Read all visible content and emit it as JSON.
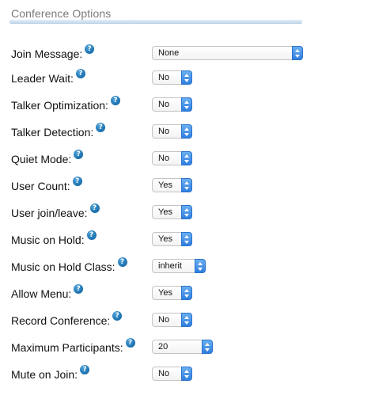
{
  "section": {
    "title": "Conference Options"
  },
  "help_icon_glyph": "?",
  "help_icon_name": "question-circle-icon",
  "accent_color": "#2f7fe0",
  "options": [
    {
      "label": "Join Message:",
      "value": "None"
    },
    {
      "label": "Leader Wait:",
      "value": "No"
    },
    {
      "label": "Talker Optimization:",
      "value": "No"
    },
    {
      "label": "Talker Detection:",
      "value": "No"
    },
    {
      "label": "Quiet Mode:",
      "value": "No"
    },
    {
      "label": "User Count:",
      "value": "Yes"
    },
    {
      "label": "User join/leave:",
      "value": "Yes"
    },
    {
      "label": "Music on Hold:",
      "value": "Yes"
    },
    {
      "label": "Music on Hold Class:",
      "value": "inherit"
    },
    {
      "label": "Allow Menu:",
      "value": "Yes"
    },
    {
      "label": "Record Conference:",
      "value": "No"
    },
    {
      "label": "Maximum Participants:",
      "value": "20"
    },
    {
      "label": "Mute on Join:",
      "value": "No"
    }
  ]
}
